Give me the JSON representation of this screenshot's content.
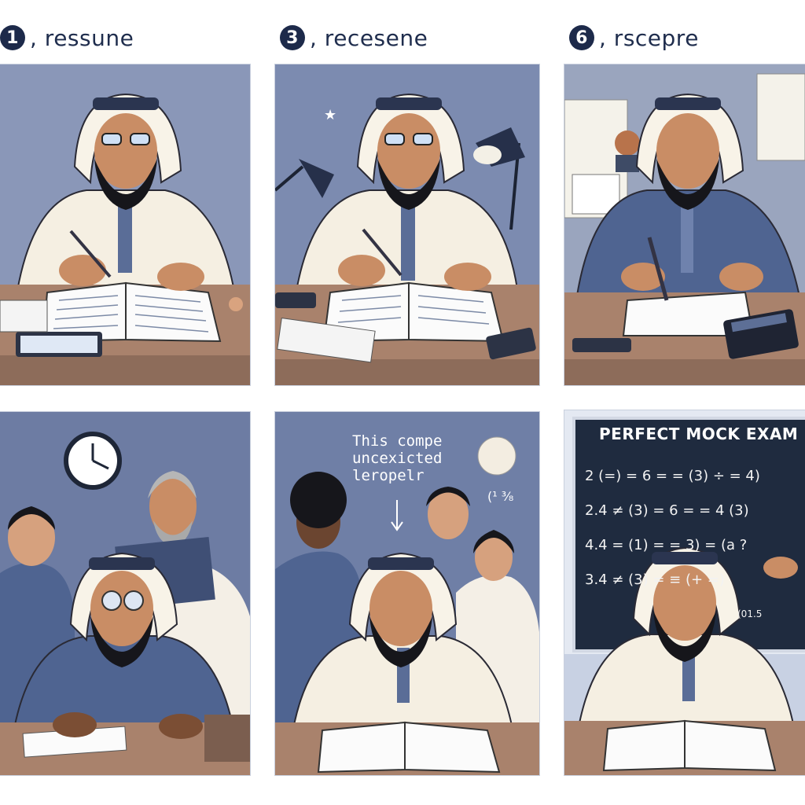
{
  "steps": [
    {
      "number": "1",
      "label": ", ressune"
    },
    {
      "number": "3",
      "label": ", recesene"
    },
    {
      "number": "6",
      "label": ", rscepre"
    }
  ],
  "caption": {
    "line1": "This compe",
    "line2": "uncexicted",
    "line3": "leropelr"
  },
  "side_note": "(¹ ³⁄₈",
  "blackboard": {
    "title": "PERFECT MOCK EXAM",
    "lines": [
      "2 (=) = 6 = = (3) ÷ = 4)",
      "2.4 ≠ (3) = 6 = = 4 (3)",
      "4.4 = (1) = = 3) = (a ?",
      "3.4 ≠ (3) = ≡ (+ =)",
      "(01.5"
    ]
  },
  "colors": {
    "scene_bg": "#6f7fa6",
    "desk": "#a9826c",
    "robe_white": "#f5efe2",
    "robe_blue": "#4f6491",
    "headband": "#2b3550",
    "beard": "#1a1a1f",
    "skin": "#c98d65",
    "board": "#1f2b3f"
  }
}
